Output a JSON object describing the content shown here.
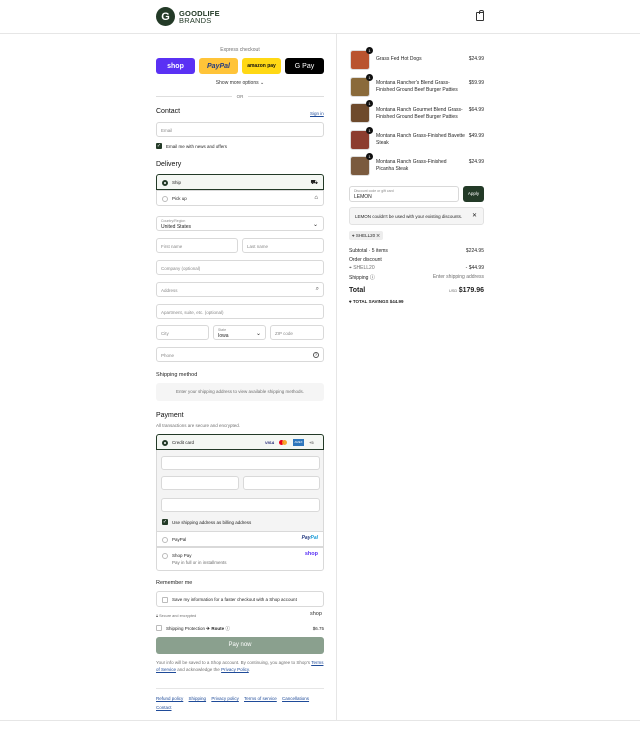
{
  "header": {
    "logo_mark": "G",
    "brand_line1": "GOODLIFE",
    "brand_line2": "BRANDS"
  },
  "express": {
    "title": "Express checkout",
    "shop": "shop",
    "paypal": "PayPal",
    "amazon": "amazon pay",
    "gpay": "G Pay",
    "show_more": "Show more options",
    "or": "OR"
  },
  "contact": {
    "title": "Contact",
    "sign_in": "Sign in",
    "email_placeholder": "Email",
    "news_label": "Email me with news and offers"
  },
  "delivery": {
    "title": "Delivery",
    "ship": "Ship",
    "pickup": "Pick up",
    "country_label": "Country/Region",
    "country_value": "United States",
    "first_name": "First name",
    "last_name": "Last name",
    "company": "Company (optional)",
    "address": "Address",
    "apartment": "Apartment, suite, etc. (optional)",
    "city": "City",
    "state_label": "State",
    "state_value": "Iowa",
    "zip": "ZIP code",
    "phone": "Phone"
  },
  "shipping_method": {
    "title": "Shipping method",
    "message": "Enter your shipping address to view available shipping methods."
  },
  "payment": {
    "title": "Payment",
    "subtitle": "All transactions are secure and encrypted.",
    "credit_card": "Credit card",
    "visa": "VISA",
    "amex": "AMEX",
    "more_cards": "+5",
    "billing_same": "Use shipping address as billing address",
    "paypal": "PayPal",
    "shop_pay": "Shop Pay",
    "shop_pay_sub": "Pay in full or in installments",
    "shop_logo": "shop"
  },
  "remember": {
    "title": "Remember me",
    "save_info": "Save my information for a faster checkout with a Shop account",
    "secure": "Secure and encrypted",
    "shop_logo": "shop"
  },
  "protection": {
    "label": "Shipping Protection",
    "route": "Route",
    "price": "$6.75"
  },
  "pay_now": "Pay now",
  "terms": {
    "text1": "Your info will be saved to a Shop account. By continuing, you agree to Shop's",
    "tos": "Terms of Service",
    "text2": "and acknowledge the",
    "privacy": "Privacy Policy",
    "period": "."
  },
  "footer_links": [
    "Refund policy",
    "Shipping",
    "Privacy policy",
    "Terms of service",
    "Cancellations",
    "Contact"
  ],
  "cart": {
    "items": [
      {
        "name": "Grass Fed Hot Dogs",
        "price": "$24.99",
        "qty": "1",
        "color": "#b9542f"
      },
      {
        "name": "Montana Rancher's Blend Grass-Finished Ground Beef Burger Patties",
        "price": "$59.99",
        "qty": "1",
        "color": "#8a6a3a"
      },
      {
        "name": "Montana Ranch Gourmet Blend Grass-Finished Ground Beef Burger Patties",
        "price": "$64.99",
        "qty": "1",
        "color": "#6e4a2c"
      },
      {
        "name": "Montana Ranch Grass-Finished Bavette Steak",
        "price": "$49.99",
        "qty": "1",
        "color": "#8c3d2f"
      },
      {
        "name": "Montana Ranch Grass-Finished Picanha Steak",
        "price": "$24.99",
        "qty": "1",
        "color": "#7a5a3e"
      }
    ],
    "discount_label": "Discount code or gift card",
    "discount_value": "LEMON",
    "apply": "Apply",
    "error": "LEMON couldn't be used with your existing discounts.",
    "applied_code": "SHELL20",
    "subtotal_label": "Subtotal · 5 items",
    "subtotal": "$224.95",
    "order_discount_label": "Order discount",
    "discount_code": "SHELL20",
    "discount_amount": "- $44.99",
    "shipping_label": "Shipping",
    "shipping_value": "Enter shipping address",
    "total_label": "Total",
    "currency": "USD",
    "total": "$179.96",
    "savings_label": "TOTAL SAVINGS",
    "savings": "$44.99"
  }
}
